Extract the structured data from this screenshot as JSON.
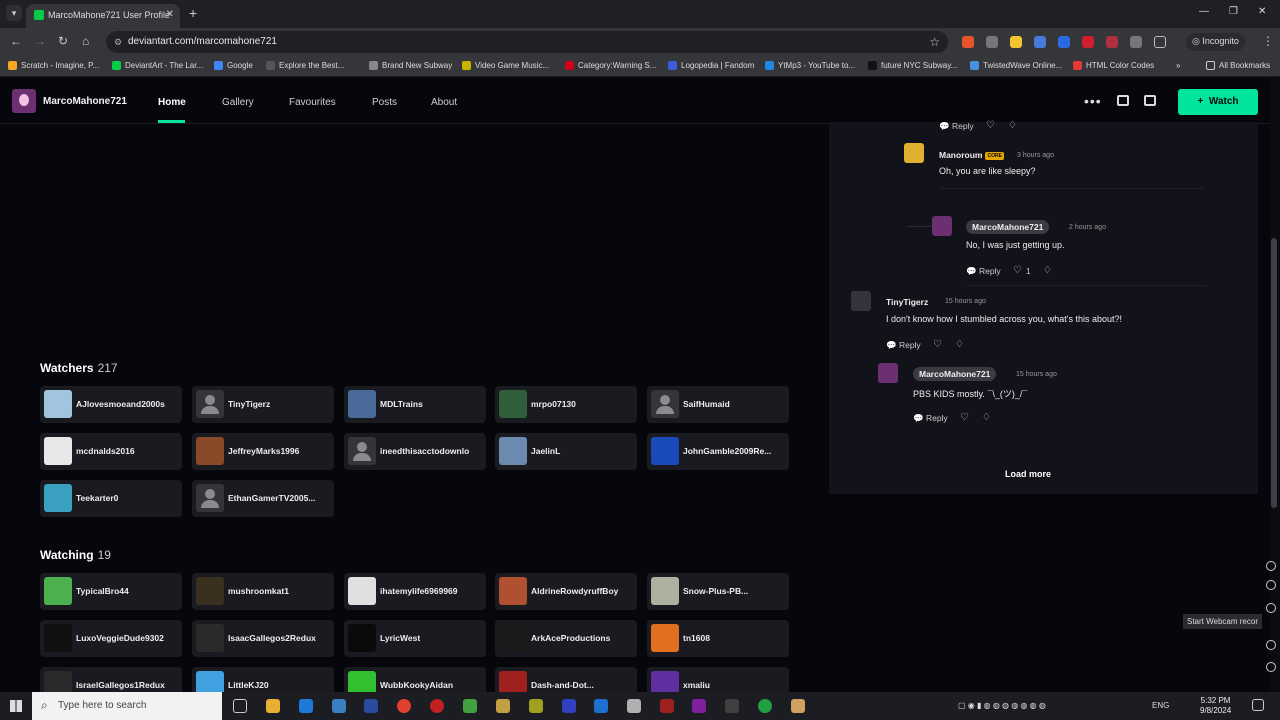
{
  "browser": {
    "tab_title": "MarcoMahone721 User Profile",
    "url": "deviantart.com/marcomahone721",
    "incognito_label": "Incognito",
    "all_bookmarks_label": "All Bookmarks",
    "bookmarks": [
      {
        "label": "Scratch - Imagine, P...",
        "color": "#f5a623"
      },
      {
        "label": "DeviantArt - The Lar...",
        "color": "#05cc47"
      },
      {
        "label": "Google",
        "color": "#4285f4"
      },
      {
        "label": "Explore the Best...",
        "color": "#555555"
      },
      {
        "label": "Brand New Subway",
        "color": "#888888"
      },
      {
        "label": "Video Game Music...",
        "color": "#c8b400"
      },
      {
        "label": "Category:Warning S...",
        "color": "#d0021b"
      },
      {
        "label": "Logopedia | Fandom",
        "color": "#3b5bdb"
      },
      {
        "label": "YtMp3 - YouTube to...",
        "color": "#1e88e5"
      },
      {
        "label": "future NYC Subway...",
        "color": "#111111"
      },
      {
        "label": "TwistedWave Online...",
        "color": "#4a90e2"
      },
      {
        "label": "HTML Color Codes",
        "color": "#e53935"
      }
    ]
  },
  "nav": {
    "username": "MarcoMahone721",
    "links": [
      "Home",
      "Gallery",
      "Favourites",
      "Posts",
      "About"
    ],
    "watch_label": "Watch",
    "watch_icon": "+",
    "accent": "#00e59b"
  },
  "watchers": {
    "title": "Watchers",
    "count": "217",
    "items": [
      {
        "name": "AJlovesmoeand2000s",
        "thumb": "#a3c4e0"
      },
      {
        "name": "TinyTigerz",
        "thumb": "default"
      },
      {
        "name": "MDLTrains",
        "thumb": "#4a6a9a"
      },
      {
        "name": "mrpo07130",
        "thumb": "#2e5e3a"
      },
      {
        "name": "SaifHumaid",
        "thumb": "default"
      },
      {
        "name": "mcdnalds2016",
        "thumb": "#e8e8e8"
      },
      {
        "name": "JeffreyMarks1996",
        "thumb": "#8a4a2a"
      },
      {
        "name": "ineedthisacctodownlo",
        "thumb": "default"
      },
      {
        "name": "JaelinL",
        "thumb": "#6a8ab0"
      },
      {
        "name": "JohnGamble2009Re...",
        "thumb": "#1a4ab8"
      },
      {
        "name": "Teekarter0",
        "thumb": "#3aa0c0"
      },
      {
        "name": "EthanGamerTV2005...",
        "thumb": "default"
      }
    ]
  },
  "watching": {
    "title": "Watching",
    "count": "19",
    "items": [
      {
        "name": "TypicalBro44",
        "thumb": "#4caf50"
      },
      {
        "name": "mushroomkat1",
        "thumb": "#3a3020"
      },
      {
        "name": "ihatemylife6969969",
        "thumb": "#e0e0e0"
      },
      {
        "name": "AldrineRowdyruffBoy",
        "thumb": "#b05030"
      },
      {
        "name": "Snow-Plus-PB...",
        "thumb": "#b0b0a0"
      },
      {
        "name": "LuxoVeggieDude9302",
        "thumb": "#101010"
      },
      {
        "name": "IsaacGallegos2Redux",
        "thumb": "#2a2a2a"
      },
      {
        "name": "LyricWest",
        "thumb": "#0a0a0a"
      },
      {
        "name": "ArkAceProductions",
        "thumb": "#1a1a1a"
      },
      {
        "name": "tn1608",
        "thumb": "#e07020"
      },
      {
        "name": "IsraelGallegos1Redux",
        "thumb": "#2a2a2a"
      },
      {
        "name": "LittleKJ20",
        "thumb": "#40a0e0"
      },
      {
        "name": "WubbKookyAidan",
        "thumb": "#30c030"
      },
      {
        "name": "Dash-and-Dot...",
        "thumb": "#a02020"
      },
      {
        "name": "xmaliu",
        "thumb": "#6030a0"
      }
    ]
  },
  "comments": {
    "reply_label": "Reply",
    "load_more_label": "Load more",
    "items": [
      {
        "author": "Manoroum",
        "core": "CORE",
        "time": "3 hours ago",
        "text": "Oh, you are like sleepy?"
      },
      {
        "author": "MarcoMahone721",
        "time": "2 hours ago",
        "text": "No, I was just getting up.",
        "likes": "1"
      },
      {
        "author": "TinyTigerz",
        "time": "15 hours ago",
        "text": "I don't know how I stumbled across you, what's this about?!"
      },
      {
        "author": "MarcoMahone721",
        "time": "15 hours ago",
        "text": "PBS KIDS mostly. ¯\\_(ツ)_/¯"
      }
    ]
  },
  "overlay": {
    "webcam_tip": "Start Webcam recor"
  },
  "taskbar": {
    "search_placeholder": "Type here to search",
    "lang": "ENG",
    "time": "5:32 PM",
    "date": "9/8/2024"
  }
}
